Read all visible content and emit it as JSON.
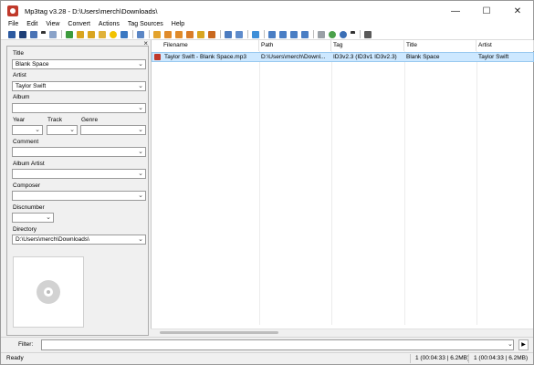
{
  "window": {
    "title": "Mp3tag v3.28  -  D:\\Users\\merch\\Downloads\\",
    "controls": {
      "minimize": "—",
      "maximize": "☐",
      "close": "✕"
    }
  },
  "menu": [
    "File",
    "Edit",
    "View",
    "Convert",
    "Actions",
    "Tag Sources",
    "Help"
  ],
  "toolbar": {
    "icons": [
      "save-icon",
      "delete-icon",
      "undo-icon",
      "dropdown-icon",
      "redo-icon",
      "tag-filename-icon",
      "filename-tag-icon",
      "filename-filename-icon",
      "text-tag-icon",
      "favorites-icon",
      "refresh-icon",
      "grid-icon",
      "export-icon",
      "tag-copy-icon",
      "tag-paste-icon",
      "tag-remove-icon",
      "tag-rename-icon",
      "case-icon",
      "case-dropdown-icon",
      "edit-icon",
      "numbering-icon",
      "numbering2-icon",
      "numbering3-icon",
      "print-icon",
      "web-icon",
      "web2-icon",
      "web-dropdown-icon",
      "settings-icon"
    ]
  },
  "tag_panel": {
    "close_label": "×",
    "title": {
      "label": "Title",
      "value": "Blank Space"
    },
    "artist": {
      "label": "Artist",
      "value": "Taylor Swift"
    },
    "album": {
      "label": "Album",
      "value": ""
    },
    "year": {
      "label": "Year",
      "value": ""
    },
    "track": {
      "label": "Track",
      "value": ""
    },
    "genre": {
      "label": "Genre",
      "value": ""
    },
    "comment": {
      "label": "Comment",
      "value": ""
    },
    "album_artist": {
      "label": "Album Artist",
      "value": ""
    },
    "composer": {
      "label": "Composer",
      "value": ""
    },
    "discnumber": {
      "label": "Discnumber",
      "value": ""
    },
    "directory": {
      "label": "Directory",
      "value": "D:\\Users\\merch\\Downloads\\"
    }
  },
  "file_list": {
    "columns": [
      "Filename",
      "Path",
      "Tag",
      "Title",
      "Artist"
    ],
    "rows": [
      {
        "filename": "Taylor Swift - Blank Space.mp3",
        "path": "D:\\Users\\merch\\Downl...",
        "tag": "ID3v2.3 (ID3v1 ID3v2.3)",
        "title": "Blank Space",
        "artist": "Taylor Swift"
      }
    ]
  },
  "filter": {
    "label": "Filter:",
    "value": ""
  },
  "status": {
    "left": "Ready",
    "selected": "1 (00:04:33 | 6.2MB)",
    "total": "1 (00:04:33 | 6.2MB)"
  }
}
